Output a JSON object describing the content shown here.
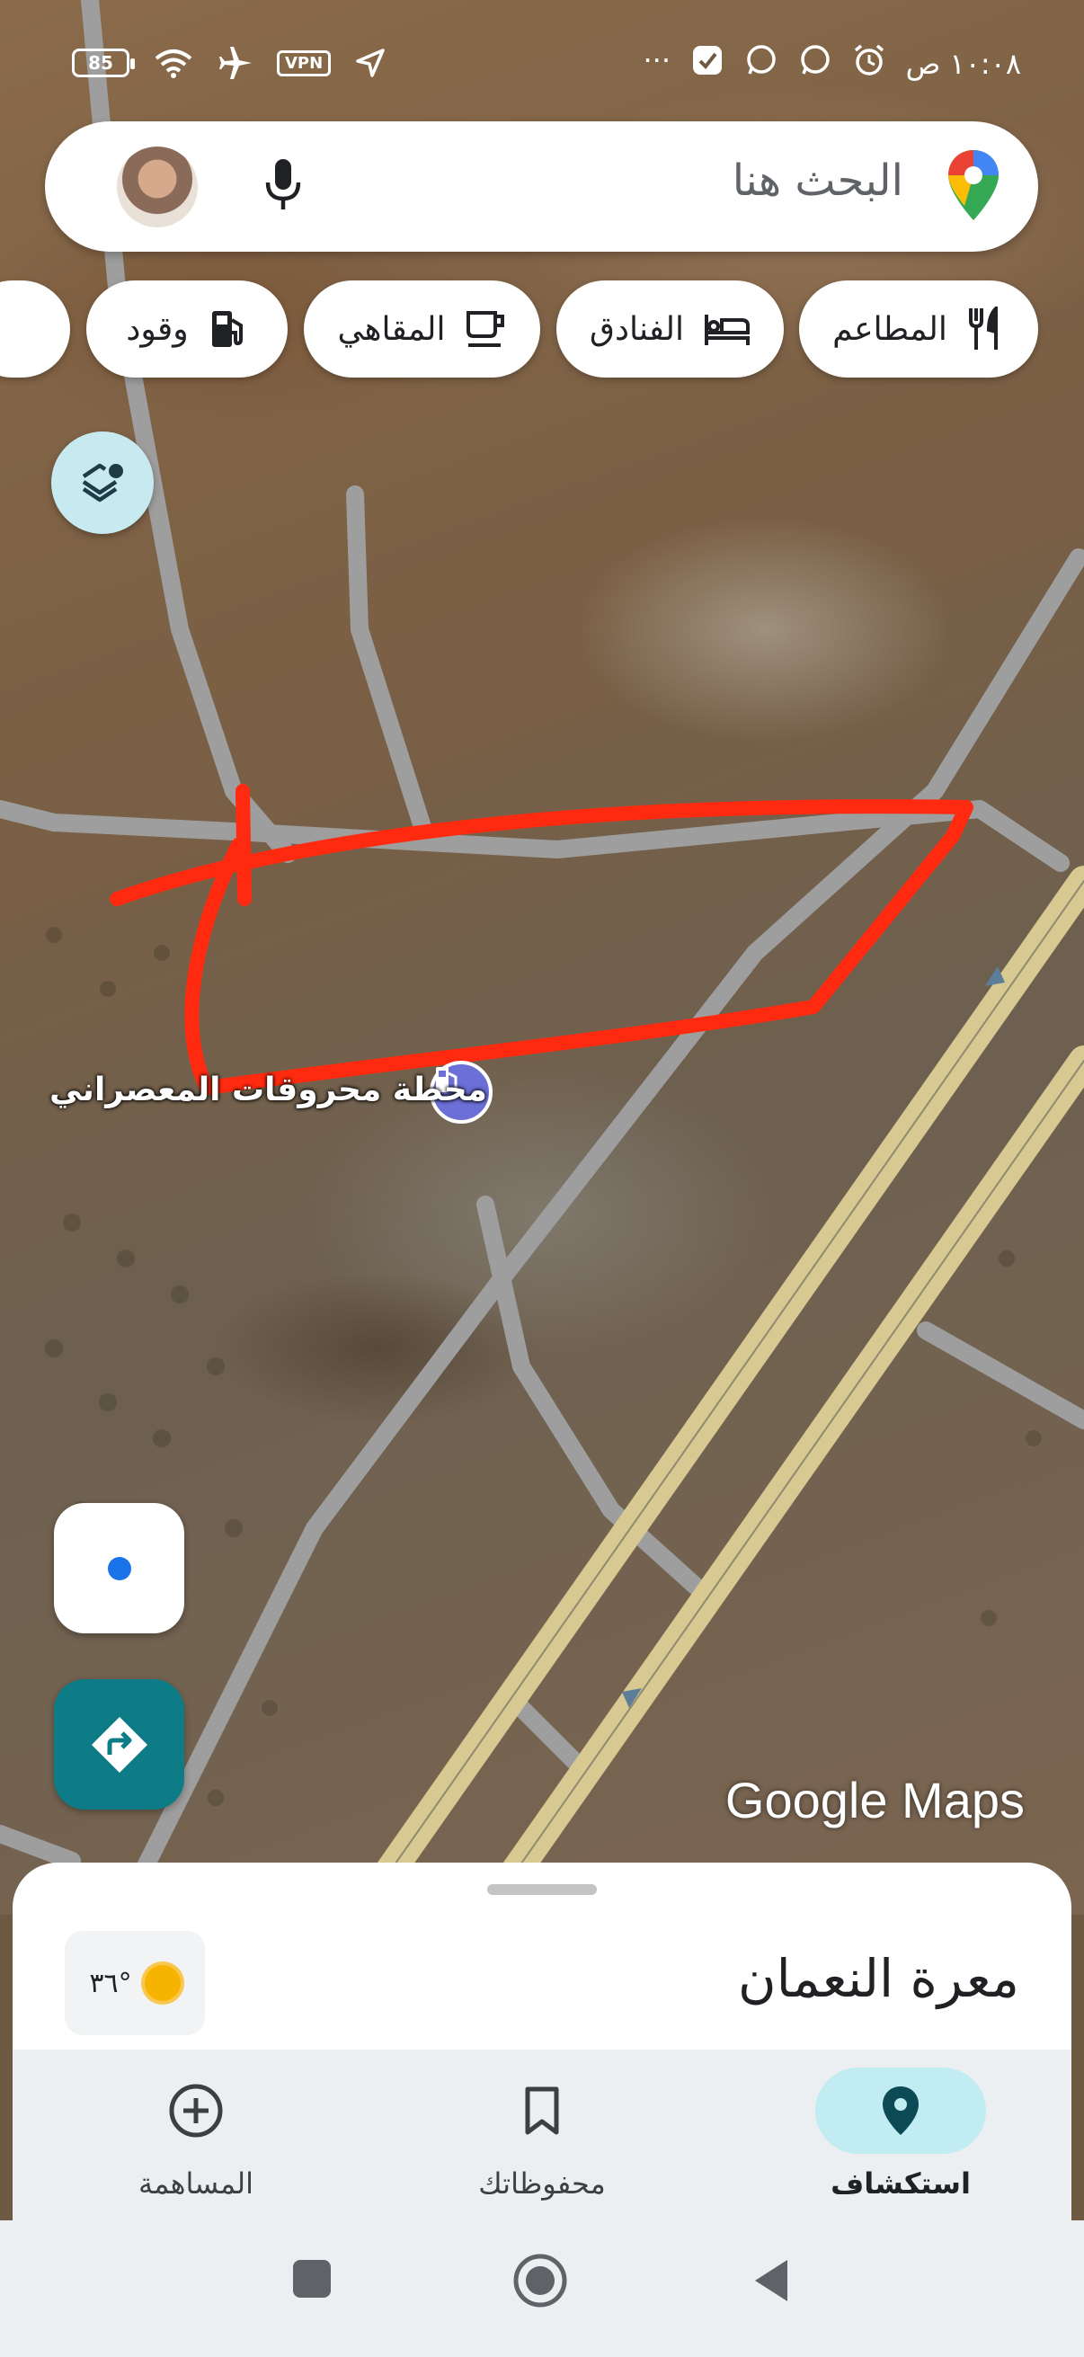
{
  "status_bar": {
    "time": "١٠:٠٨ ص",
    "battery": "85",
    "vpn": "VPN",
    "more": "···"
  },
  "search": {
    "placeholder": "البحث هنا"
  },
  "chips": [
    {
      "label": "المطاعم",
      "icon": "restaurant-icon"
    },
    {
      "label": "الفنادق",
      "icon": "hotel-icon"
    },
    {
      "label": "المقاهي",
      "icon": "cafe-icon"
    },
    {
      "label": "وقود",
      "icon": "fuel-icon"
    }
  ],
  "map": {
    "poi_label": "محطة محروقات المعصراني",
    "watermark": "Google Maps",
    "annotation_color": "#ff2a10"
  },
  "sheet": {
    "place_name": "معرة النعمان",
    "weather": "٣٦°"
  },
  "bottom_nav": {
    "explore": "استكشاف",
    "saved": "محفوظاتك",
    "contribute": "المساهمة"
  },
  "colors": {
    "accent": "#0e7c86",
    "active_nav_bg": "#c1ecf2"
  }
}
